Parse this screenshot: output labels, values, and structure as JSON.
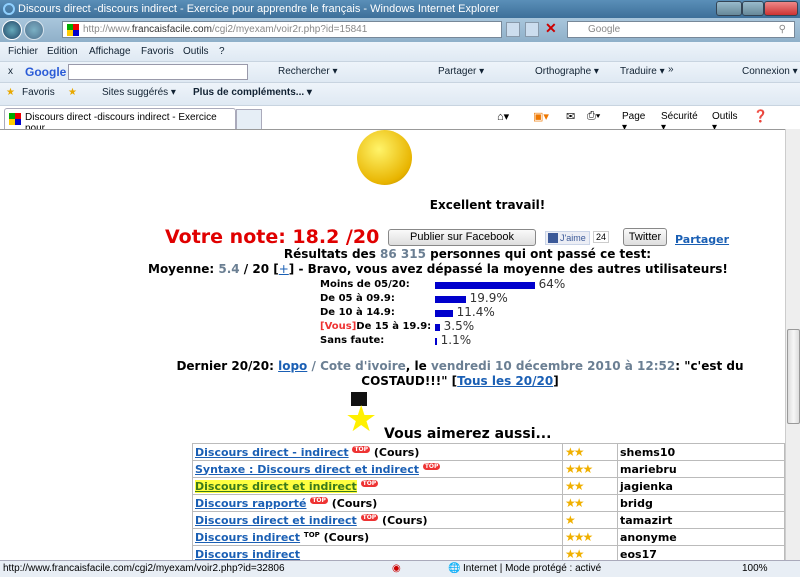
{
  "window": {
    "title": "Discours direct -discours indirect - Exercice pour apprendre le français - Windows Internet Explorer"
  },
  "address": {
    "url_prefix": "http://www.",
    "url_domain": "francaisfacile.com",
    "url_path": "/cgi2/myexam/voir2r.php?id=15841",
    "search_placeholder": "Google"
  },
  "menu": [
    "Fichier",
    "Edition",
    "Affichage",
    "Favoris",
    "Outils",
    "?"
  ],
  "google_toolbar": {
    "logo": "Google",
    "close": "x",
    "items": [
      "Rechercher ▾",
      "Partager ▾",
      "Orthographe ▾",
      "Traduire ▾",
      "»",
      "Connexion ▾"
    ]
  },
  "favorites_bar": {
    "favoris": "Favoris",
    "sites": "Sites suggérés ▾",
    "plus": "Plus de compléments... ▾"
  },
  "tab": {
    "title": "Discours direct -discours indirect - Exercice pour ..."
  },
  "command_bar": [
    "Page ▾",
    "Sécurité ▾",
    "Outils ▾"
  ],
  "page": {
    "praise": "Excellent travail!",
    "score": "Votre note: 18.2 /20",
    "facebook_button": "Publier sur Facebook",
    "like": "J'aime",
    "like_count": "24",
    "twitter_button": "Twitter",
    "share_link": "Partager",
    "results_pre": "Résultats des ",
    "results_count": "86 315",
    "results_post": " personnes qui ont passé ce test:",
    "avg_label": "Moyenne: ",
    "avg_value": "5.4",
    "avg_of": " / 20 [",
    "avg_plus": "+",
    "avg_post": "] - Bravo, vous avez dépassé la moyenne des autres utilisateurs!",
    "distribution": [
      {
        "label": "Moins de 05/20:",
        "percent": 64,
        "text": "64%"
      },
      {
        "label": "De 05 à 09.9:",
        "percent": 19.9,
        "text": "19.9%"
      },
      {
        "label": "De 10 à 14.9:",
        "percent": 11.4,
        "text": "11.4%"
      },
      {
        "label": "De 15 à 19.9:",
        "percent": 3.5,
        "text": "3.5%",
        "you": "[Vous]"
      },
      {
        "label": "Sans faute:",
        "percent": 1.1,
        "text": "1.1%"
      }
    ],
    "last_label": "Dernier 20/20: ",
    "last_user": "lopo",
    "last_sep": " / ",
    "last_country": "Cote d'ivoire",
    "last_le": ", le ",
    "last_date": "vendredi 10 décembre 2010 à 12:52",
    "last_quote": ": \"c'est du COSTAUD!!!\" [",
    "all_link": "Tous les 20/20",
    "last_end": "]",
    "also_title": "Vous aimerez aussi...",
    "also": [
      {
        "title": "Discours direct - indirect",
        "top": "TOP",
        "extra": "(Cours)",
        "stars": 2,
        "user": "shems10"
      },
      {
        "title": "Syntaxe : Discours direct et indirect",
        "top": "TOP",
        "extra": "",
        "stars": 3,
        "user": "mariebru"
      },
      {
        "title": "Discours direct et indirect",
        "top": "TOP",
        "extra": "",
        "stars": 2,
        "user": "jagienka",
        "highlight": true
      },
      {
        "title": "Discours rapporté",
        "top": "TOP",
        "extra": "(Cours)",
        "stars": 2,
        "user": "bridg"
      },
      {
        "title": "Discours direct et indirect",
        "top": "TOP",
        "extra": "(Cours)",
        "stars": 1,
        "user": "tamazirt"
      },
      {
        "title": "Discours indirect",
        "top": "TOP",
        "extra": "(Cours)",
        "stars": 3,
        "user": "anonyme"
      },
      {
        "title": "Discours indirect",
        "top": "",
        "extra": "",
        "stars": 2,
        "user": "eos17"
      }
    ]
  },
  "status": {
    "url": "http://www.francaisfacile.com/cgi2/myexam/voir2.php?id=32806",
    "zone": "Internet | Mode protégé : activé",
    "zoom": "100%"
  },
  "colors": {
    "score": "#e00000",
    "bar": "#0000cc",
    "link": "#1a5fb4",
    "highlight": "#ffff40"
  }
}
